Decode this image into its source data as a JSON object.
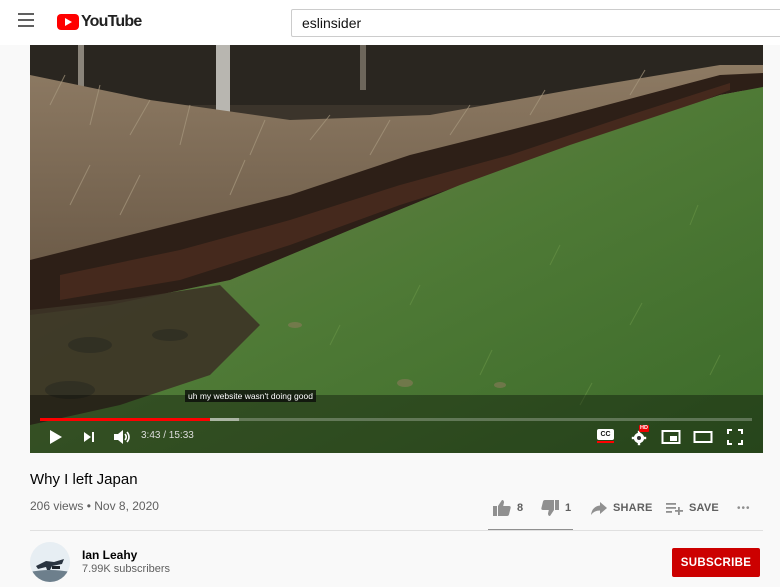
{
  "header": {
    "logo_text": "YouTube",
    "search_value": "eslinsider"
  },
  "player": {
    "caption": "uh my website wasn't doing good",
    "time_current": "3:43",
    "time_total": "15:33",
    "time_display": "3:43 / 15:33",
    "progress_fraction": 0.239,
    "loaded_fraction": 0.28,
    "hd_badge": "HD",
    "cc_label": "CC"
  },
  "video": {
    "title": "Why I left Japan",
    "meta": "206 views • Nov 8, 2020",
    "likes": "8",
    "dislikes": "1",
    "share_label": "SHARE",
    "save_label": "SAVE",
    "more_label": "•••"
  },
  "channel": {
    "name": "Ian Leahy",
    "subscribers": "7.99K subscribers",
    "subscribe_label": "SUBSCRIBE"
  },
  "colors": {
    "brand": "#ff0000",
    "subscribe": "#cc0000",
    "progress": "#ff0000"
  }
}
